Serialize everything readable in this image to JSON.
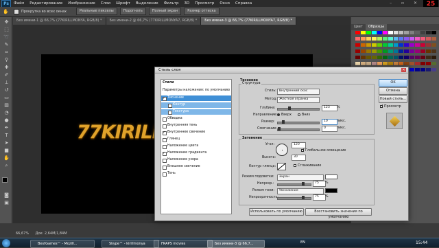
{
  "menubar": {
    "logo": "Ps",
    "items": [
      "Файл",
      "Редактирование",
      "Изображение",
      "Слои",
      "Шрифт",
      "Выделение",
      "Фильтр",
      "3D",
      "Просмотр",
      "Окно",
      "Справка"
    ],
    "fps": "25"
  },
  "optbar": {
    "checkbox_label": "Прокрутка во всех окнах",
    "buttons": [
      "Реальные пикселы",
      "Подогнать",
      "Полный экран",
      "Размер оттиска"
    ]
  },
  "tabs": [
    "Без имени-1 @ 66,7% (77KIRILLMONYA, RGB/8) *",
    "Без имени-2 @ 66,7% (77KIRILLMONYA7, RGB/8) *",
    "Без имени-3 @ 66,7% (77KIRILLMONYA7, RGB/8) *"
  ],
  "canvas": {
    "text": "77KIRILL"
  },
  "status": {
    "zoom": "66,67%",
    "doc": "Док: 2,64M/1,84M"
  },
  "swatches": {
    "tabs": [
      "Цвет",
      "Образцы"
    ],
    "colors": [
      "#ff0000",
      "#ffff00",
      "#00ff00",
      "#00ffff",
      "#0000ff",
      "#ff00ff",
      "#ffffff",
      "#e0e0e0",
      "#c0c0c0",
      "#a0a0a0",
      "#808080",
      "#606060",
      "#404040",
      "#202020",
      "#000000",
      "#ff6a6a",
      "#ff9c5a",
      "#ffd35a",
      "#fff35a",
      "#b8f25a",
      "#5af27a",
      "#5af2d3",
      "#5ab8f2",
      "#5a7af2",
      "#8a5af2",
      "#c85af2",
      "#f25ac0",
      "#f25a7a",
      "#d25a5a",
      "#b06040",
      "#cc0000",
      "#cc6600",
      "#cc9900",
      "#cccc00",
      "#66cc00",
      "#00cc33",
      "#00cc99",
      "#0099cc",
      "#0033cc",
      "#3300cc",
      "#9900cc",
      "#cc0099",
      "#cc0033",
      "#993333",
      "#805020",
      "#990000",
      "#994400",
      "#997700",
      "#999900",
      "#449900",
      "#009922",
      "#009977",
      "#007799",
      "#002299",
      "#220099",
      "#770099",
      "#990077",
      "#990022",
      "#663300",
      "#4d3319",
      "#660000",
      "#663300",
      "#665500",
      "#666600",
      "#336600",
      "#006611",
      "#006655",
      "#005566",
      "#001166",
      "#110066",
      "#550066",
      "#660055",
      "#660011",
      "#3d2b14",
      "#2b1a0a",
      "#f5deb3",
      "#deb887",
      "#d2b48c",
      "#bc8f8f",
      "#f4a460",
      "#daa520",
      "#b8860b",
      "#cd853f",
      "#d2691e",
      "#8b4513",
      "#a0522d",
      "#a52a2a",
      "#800000",
      "#8b0000",
      "#556b2f",
      "#e6e6fa",
      "#b0c4de",
      "#add8e6",
      "#87ceeb",
      "#87cefa",
      "#00bfff",
      "#1e90ff",
      "#6495ed",
      "#4682b4",
      "#4169e1",
      "#0000cd",
      "#00008b",
      "#000080",
      "#191970",
      "#483d8b"
    ]
  },
  "dialog": {
    "title": "Стиль слоя",
    "list": {
      "header": "Стили",
      "blend_options": "Параметры наложения: по умолчанию",
      "items": [
        {
          "label": "Тиснение",
          "checked": true,
          "state": "selected"
        },
        {
          "label": "Контур",
          "checked": false,
          "state": "sub"
        },
        {
          "label": "Текстура",
          "checked": false,
          "state": "sub"
        },
        {
          "label": "Обводка",
          "checked": false,
          "state": ""
        },
        {
          "label": "Внутренняя тень",
          "checked": false,
          "state": ""
        },
        {
          "label": "Внутреннее свечение",
          "checked": true,
          "state": ""
        },
        {
          "label": "Глянец",
          "checked": false,
          "state": ""
        },
        {
          "label": "Наложение цвета",
          "checked": false,
          "state": ""
        },
        {
          "label": "Наложение градиента",
          "checked": true,
          "state": ""
        },
        {
          "label": "Наложение узора",
          "checked": false,
          "state": ""
        },
        {
          "label": "Внешнее свечение",
          "checked": false,
          "state": ""
        },
        {
          "label": "Тень",
          "checked": false,
          "state": ""
        }
      ]
    },
    "bevel": {
      "title": "Тиснение",
      "structure": "Структура",
      "style_label": "Стиль:",
      "style_value": "Внутренний скос",
      "method_label": "Метод:",
      "method_value": "Жесткая огранка",
      "depth_label": "Глубина:",
      "depth_value": "123",
      "depth_unit": "%",
      "depth_level": 0.25,
      "direction_label": "Направление:",
      "up": "Вверх",
      "down": "Вниз",
      "size_label": "Размер:",
      "size_value": "10",
      "size_unit": "пикс.",
      "size_level": 0.1,
      "soften_label": "Смягчение:",
      "soften_value": "0",
      "soften_unit": "пикс.",
      "soften_level": 0
    },
    "shading": {
      "title": "Затенение",
      "angle_label": "Угол:",
      "angle_value": "120",
      "global_light": "Глобальное освещение",
      "altitude_label": "Высота:",
      "altitude_value": "30",
      "gloss_label": "Контур глянца:",
      "antialias": "Сглаживание",
      "highlight_mode_label": "Режим подсветки:",
      "highlight_mode": "Экран",
      "highlight_color": "#ffffff",
      "hl_opacity_label": "Непрозр.:",
      "hl_opacity": "75",
      "hl_unit": "%",
      "hl_level": 0.75,
      "shadow_mode_label": "Режим тени:",
      "shadow_mode": "Умножение",
      "shadow_color": "#000000",
      "sh_opacity_label": "Непрозрачность:",
      "sh_opacity": "75",
      "sh_unit": "%",
      "sh_level": 0.75
    },
    "buttons": {
      "default": "Использовать по умолчанию",
      "restore": "Восстановить значения по умолчанию",
      "ok": "OK",
      "cancel": "Отмена",
      "new_style": "Новый стиль...",
      "preview": "Просмотр"
    }
  },
  "taskbar": {
    "items": [
      "BestGames™ - Mozill...",
      "Skype™ - kirillmonya",
      "FRAPS movies",
      "Без имени-3 @ 66,7..."
    ],
    "lang": "EN",
    "clock": "15:44"
  }
}
